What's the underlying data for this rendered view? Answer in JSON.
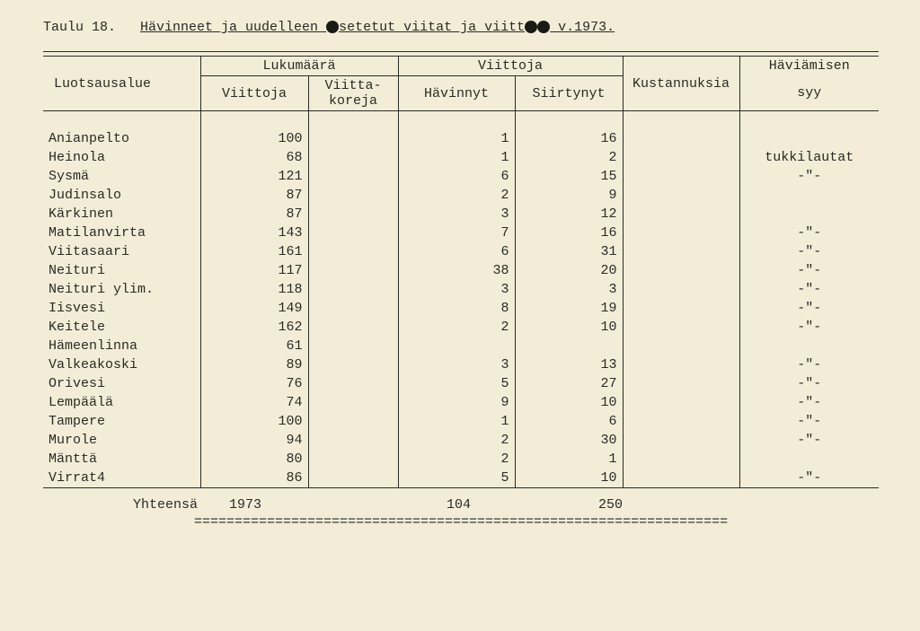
{
  "title": {
    "prefix": "Taulu 18.",
    "part1": "Hävinneet  ja  uudelleen ",
    "part2": "setetut  viitat  ja  viitt",
    "part3": "  v.1973."
  },
  "headers": {
    "luotsausalue": "Luotsausalue",
    "lukumaara": "Lukumäärä",
    "viittoja_top": "Viittoja",
    "kustannuksia": "Kustannuksia",
    "haviamisen": "Häviämisen",
    "viittoja_sub": "Viittoja",
    "viittakoreja": "Viitta-\nkoreja",
    "havinnyt": "Hävinnyt",
    "siirtynyt": "Siirtynyt",
    "syy": "syy"
  },
  "rows": [
    {
      "area": "Anianpelto",
      "viittoja": "100",
      "havinnyt": "1",
      "siirtynyt": "16",
      "syy": ""
    },
    {
      "area": "Heinola",
      "viittoja": "68",
      "havinnyt": "1",
      "siirtynyt": "2",
      "syy": "tukkilautat"
    },
    {
      "area": "Sysmä",
      "viittoja": "121",
      "havinnyt": "6",
      "siirtynyt": "15",
      "syy": "-\"-"
    },
    {
      "area": "Judinsalo",
      "viittoja": "87",
      "havinnyt": "2",
      "siirtynyt": "9",
      "syy": ""
    },
    {
      "area": "Kärkinen",
      "viittoja": "87",
      "havinnyt": "3",
      "siirtynyt": "12",
      "syy": ""
    },
    {
      "area": "Matilanvirta",
      "viittoja": "143",
      "havinnyt": "7",
      "siirtynyt": "16",
      "syy": "-\"-"
    },
    {
      "area": "Viitasaari",
      "viittoja": "161",
      "havinnyt": "6",
      "siirtynyt": "31",
      "syy": "-\"-"
    },
    {
      "area": "Neituri",
      "viittoja": "117",
      "havinnyt": "38",
      "siirtynyt": "20",
      "syy": "-\"-"
    },
    {
      "area": "Neituri ylim.",
      "viittoja": "118",
      "havinnyt": "3",
      "siirtynyt": "3",
      "syy": "-\"-"
    },
    {
      "area": "Iisvesi",
      "viittoja": "149",
      "havinnyt": "8",
      "siirtynyt": "19",
      "syy": "-\"-"
    },
    {
      "area": "Keitele",
      "viittoja": "162",
      "havinnyt": "2",
      "siirtynyt": "10",
      "syy": "-\"-"
    },
    {
      "area": "Hämeenlinna",
      "viittoja": "61",
      "havinnyt": "",
      "siirtynyt": "",
      "syy": ""
    },
    {
      "area": "Valkeakoski",
      "viittoja": "89",
      "havinnyt": "3",
      "siirtynyt": "13",
      "syy": "-\"-"
    },
    {
      "area": "Orivesi",
      "viittoja": "76",
      "havinnyt": "5",
      "siirtynyt": "27",
      "syy": "-\"-"
    },
    {
      "area": "Lempäälä",
      "viittoja": "74",
      "havinnyt": "9",
      "siirtynyt": "10",
      "syy": "-\"-"
    },
    {
      "area": "Tampere",
      "viittoja": "100",
      "havinnyt": "1",
      "siirtynyt": "6",
      "syy": "-\"-"
    },
    {
      "area": "Murole",
      "viittoja": "94",
      "havinnyt": "2",
      "siirtynyt": "30",
      "syy": "-\"-"
    },
    {
      "area": "Mänttä",
      "viittoja": "80",
      "havinnyt": "2",
      "siirtynyt": "1",
      "syy": ""
    },
    {
      "area": "Virrat4",
      "viittoja": "86",
      "havinnyt": "5",
      "siirtynyt": "10",
      "syy": "-\"-"
    }
  ],
  "totals": {
    "label": "Yhteensä",
    "viittoja": "1973",
    "havinnyt": "104",
    "siirtynyt": "250"
  },
  "double_line": "=================================================================="
}
